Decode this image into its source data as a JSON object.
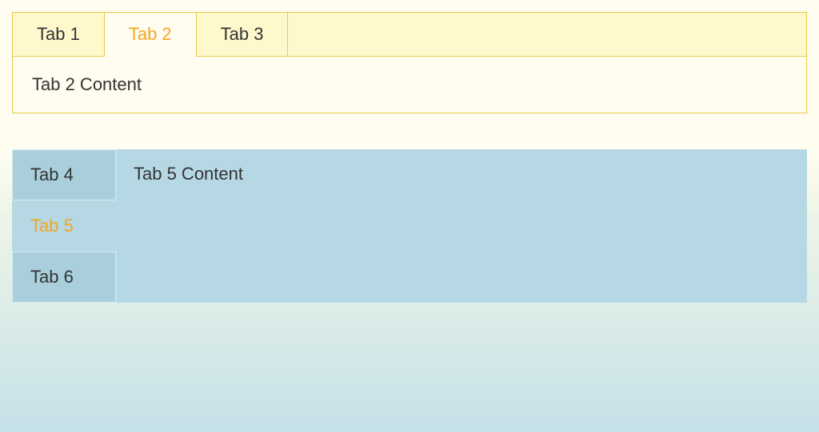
{
  "horizontal_tabs": {
    "tabs": [
      {
        "label": "Tab 1",
        "active": false
      },
      {
        "label": "Tab 2",
        "active": true
      },
      {
        "label": "Tab 3",
        "active": false
      }
    ],
    "content": "Tab 2 Content"
  },
  "vertical_tabs": {
    "tabs": [
      {
        "label": "Tab 4",
        "active": false
      },
      {
        "label": "Tab 5",
        "active": true
      },
      {
        "label": "Tab 6",
        "active": false
      }
    ],
    "content": "Tab 5 Content"
  }
}
